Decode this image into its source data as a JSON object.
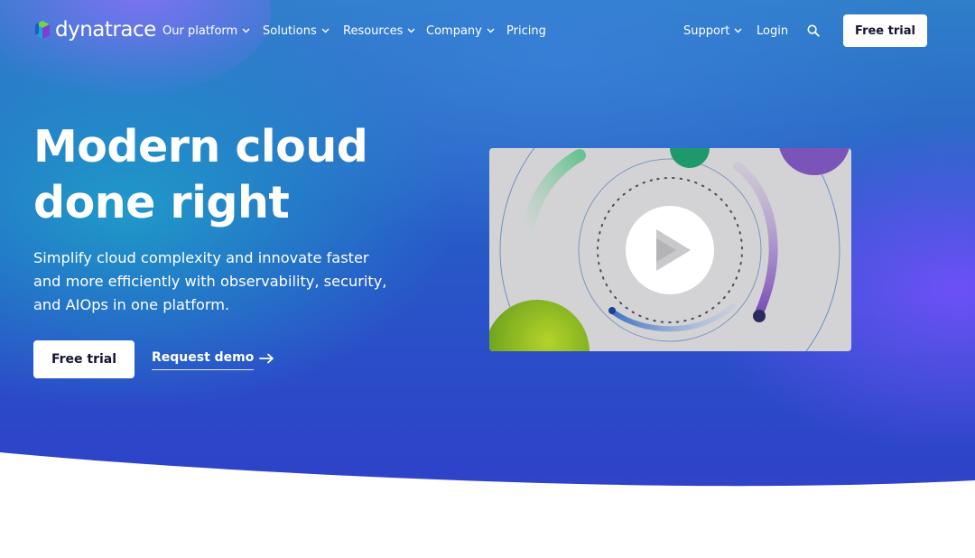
{
  "brand": {
    "name": "dynatrace"
  },
  "nav": {
    "items": [
      {
        "label": "Our platform",
        "has_dropdown": true
      },
      {
        "label": "Solutions",
        "has_dropdown": true
      },
      {
        "label": "Resources",
        "has_dropdown": true
      },
      {
        "label": "Company",
        "has_dropdown": true
      },
      {
        "label": "Pricing",
        "has_dropdown": false
      }
    ],
    "support_label": "Support",
    "login_label": "Login",
    "search_icon": "search-icon",
    "cta_label": "Free trial"
  },
  "hero": {
    "headline_line1": "Modern cloud",
    "headline_line2": "done right",
    "subtext": "Simplify cloud complexity and innovate faster and more efficiently with observability, security, and AIOps in one platform.",
    "primary_cta": "Free trial",
    "secondary_cta": "Request demo"
  },
  "video": {
    "play_icon": "play-icon"
  },
  "colors": {
    "hero_top": "#2f7fc9",
    "hero_bottom": "#3340c9",
    "accent_purple": "#7a50ff",
    "button_bg": "#ffffff",
    "button_text": "#141432",
    "video_bg": "#d3d3d5"
  }
}
